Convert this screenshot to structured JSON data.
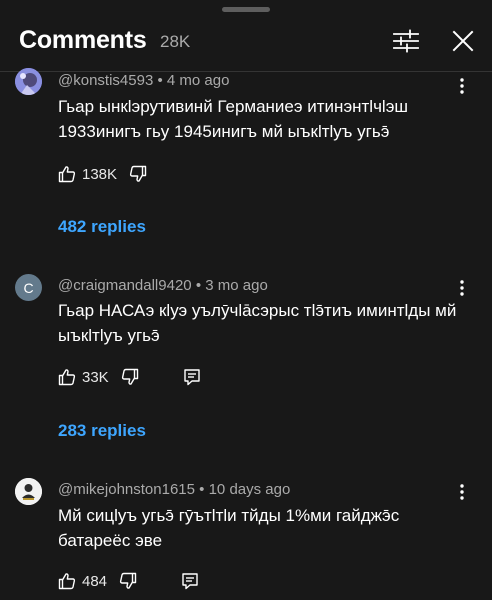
{
  "header": {
    "title": "Comments",
    "count": "28K",
    "filter_icon": "sliders-icon",
    "close_icon": "close-icon"
  },
  "comments": [
    {
      "author": "@konstis4593",
      "age": "4 mo ago",
      "text": "Гьар ынкlэрутивинй Германиеэ итинэнтlчlэш 1933инигъ гьу 1945инигъ мй ыъкlтlуъ угьэ̄",
      "likes": "138K",
      "replies": "482 replies",
      "avatar": "avatar-image"
    },
    {
      "author": "@craigmandall9420",
      "age": "3 mo ago",
      "text": "Гьар НАСАэ кlуэ уълӯчlāсэрыс тlэ̄тиъ иминтlды мй ыъкlтlуъ угьэ̄",
      "likes": "33K",
      "replies": "283 replies",
      "avatar_letter": "C",
      "avatar_color": "#637a8c"
    },
    {
      "author": "@mikejohnston1615",
      "age": "10 days ago",
      "text": "Мй сицlуъ угьэ̄ гӯътlтlи тйды 1%ми гайджэ̄с батареёс эве",
      "likes": "484",
      "avatar": "avatar-image"
    }
  ],
  "separator": "•"
}
